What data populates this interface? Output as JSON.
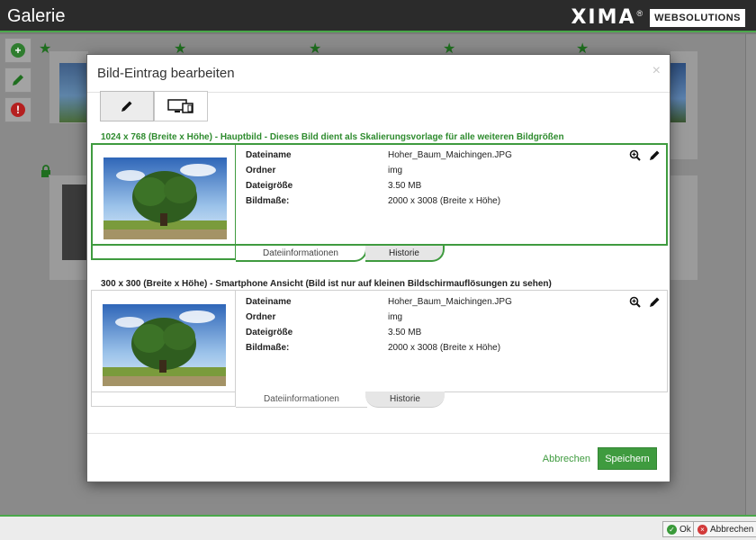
{
  "header": {
    "title": "Galerie",
    "brand": "XIMA",
    "brand_reg": "®",
    "brand_sub": "WEBSOLUTIONS"
  },
  "dialog": {
    "title": "Bild-Eintrag bearbeiten",
    "close": "×",
    "tabs": [
      {
        "icon": "pencil-icon"
      },
      {
        "icon": "devices-icon"
      }
    ],
    "entries": [
      {
        "label": "1024 x 768 (Breite x Höhe) - Hauptbild - Dieses Bild dient als Skalierungsvorlage für alle weiteren Bildgrößen",
        "fields": [
          {
            "key": "Dateiname",
            "value": "Hoher_Baum_Maichingen.JPG"
          },
          {
            "key": "Ordner",
            "value": "img"
          },
          {
            "key": "Dateigröße",
            "value": "3.50 MB"
          },
          {
            "key": "Bildmaße:",
            "value": "2000 x 3008 (Breite x Höhe)"
          }
        ],
        "subtabs": {
          "info": "Dateiinformationen",
          "history": "Historie"
        }
      },
      {
        "label": "300 x 300 (Breite x Höhe) - Smartphone Ansicht (Bild ist nur auf kleinen Bildschirmauflösungen zu sehen)",
        "fields": [
          {
            "key": "Dateiname",
            "value": "Hoher_Baum_Maichingen.JPG"
          },
          {
            "key": "Ordner",
            "value": "img"
          },
          {
            "key": "Dateigröße",
            "value": "3.50 MB"
          },
          {
            "key": "Bildmaße:",
            "value": "2000 x 3008 (Breite x Höhe)"
          }
        ],
        "subtabs": {
          "info": "Dateiinformationen",
          "history": "Historie"
        }
      }
    ],
    "footer": {
      "cancel": "Abbrechen",
      "save": "Speichern"
    }
  },
  "bottombar": {
    "ok": "Ok",
    "cancel": "Abbrechen"
  },
  "colors": {
    "accent": "#3f9b3f",
    "header_bg": "#2b2b2b"
  }
}
